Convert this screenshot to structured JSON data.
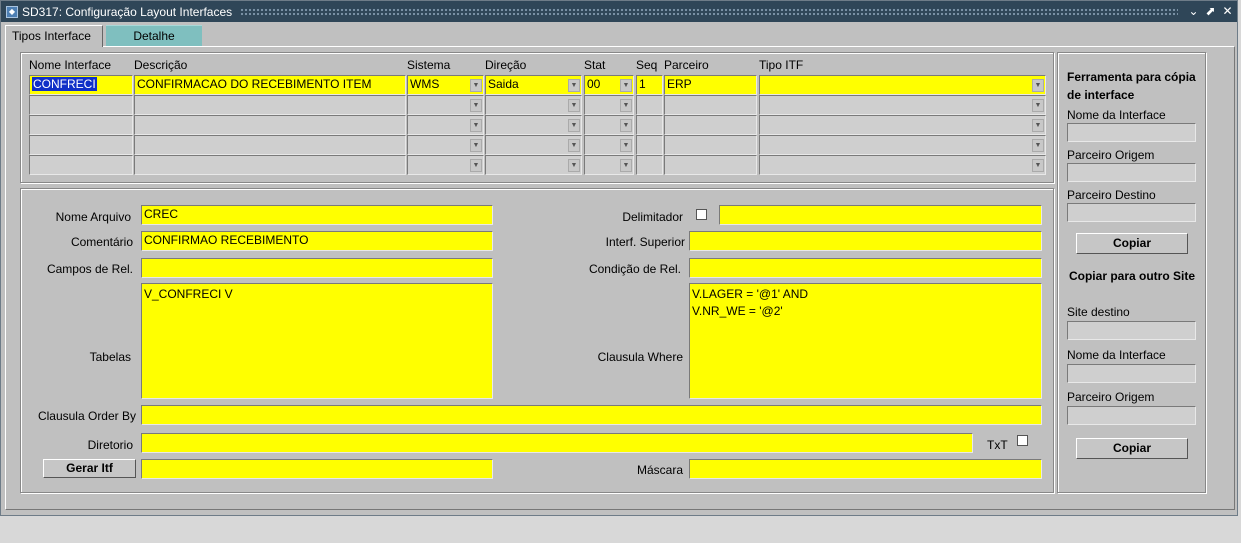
{
  "window": {
    "title": "SD317: Configuração Layout Interfaces",
    "app_icon": "oracle-forms-icon"
  },
  "tabs": [
    {
      "label": "Tipos Interface"
    },
    {
      "label": "Detalhe"
    }
  ],
  "grid": {
    "headers": {
      "nome": "Nome Interface",
      "descricao": "Descrição",
      "sistema": "Sistema",
      "direcao": "Direção",
      "stat": "Stat",
      "seq": "Seq",
      "parceiro": "Parceiro",
      "tipo_itf": "Tipo ITF"
    },
    "row1": {
      "nome": "CONFRECI",
      "descricao": "CONFIRMACAO DO RECEBIMENTO ITEM",
      "sistema": "WMS",
      "direcao": "Saida",
      "stat": "00",
      "seq": "1",
      "parceiro": "ERP",
      "tipo_itf": ""
    }
  },
  "detail": {
    "nome_arquivo_label": "Nome Arquivo",
    "nome_arquivo": "CREC",
    "comentario_label": "Comentário",
    "comentario": "CONFIRMAO RECEBIMENTO",
    "campos_rel_label": "Campos de Rel.",
    "campos_rel": "",
    "tabelas_label": "Tabelas",
    "tabelas": "V_CONFRECI V",
    "delimitador_label": "Delimitador",
    "delimitador": "",
    "interf_superior_label": "Interf. Superior",
    "interf_superior": "",
    "condicao_rel_label": "Condição de Rel.",
    "condicao_rel": "",
    "clausula_where_label": "Clausula Where",
    "clausula_where": "V.LAGER = '@1' AND\nV.NR_WE = '@2'",
    "order_by_label": "Clausula Order By",
    "order_by": "",
    "diretorio_label": "Diretorio",
    "diretorio": "",
    "txt_label": "TxT",
    "gerar_itf_label": "Gerar Itf",
    "gerar_itf_field": "",
    "mascara_label": "Máscara",
    "mascara": ""
  },
  "tool": {
    "title": "Ferramenta para cópia de interface",
    "nome_label": "Nome da Interface",
    "origem_label": "Parceiro Origem",
    "destino_label": "Parceiro Destino",
    "copiar_label": "Copiar"
  },
  "site": {
    "title": "Copiar para outro Site",
    "site_destino_label": "Site destino",
    "nome_label": "Nome da Interface",
    "origem_label": "Parceiro Origem",
    "copiar_label": "Copiar"
  }
}
